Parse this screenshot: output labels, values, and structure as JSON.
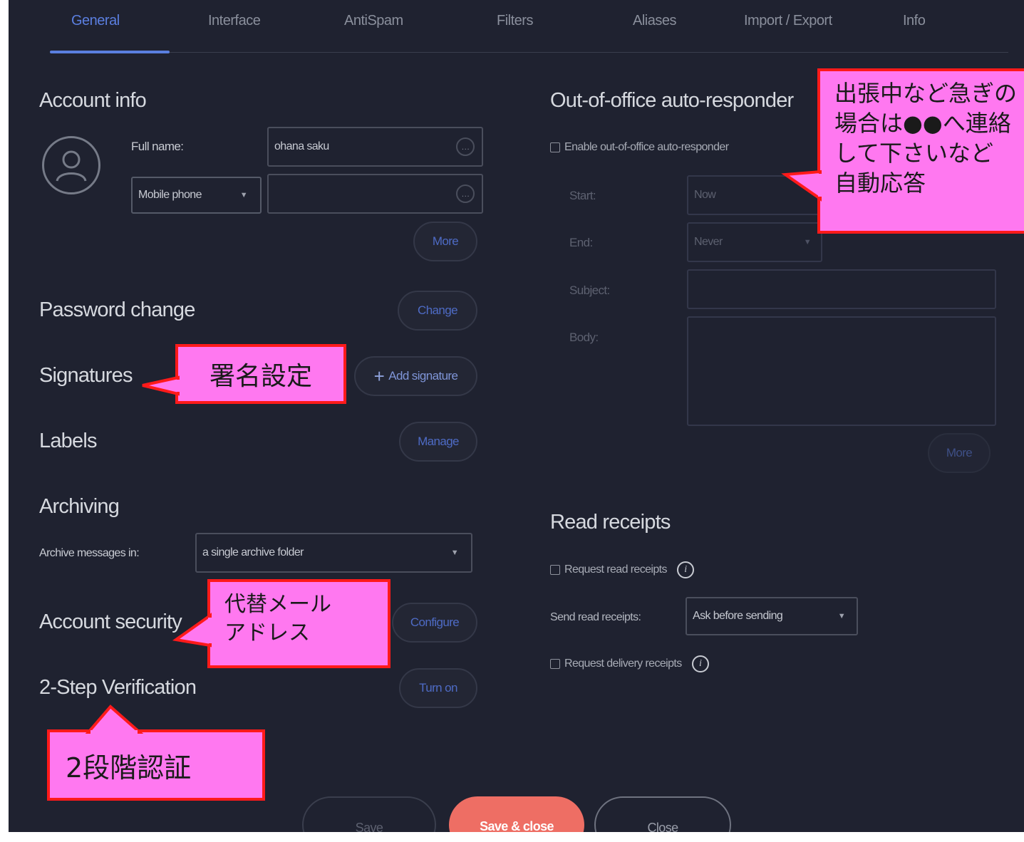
{
  "tabs": [
    {
      "label": "General",
      "active": true
    },
    {
      "label": "Interface"
    },
    {
      "label": "AntiSpam"
    },
    {
      "label": "Filters"
    },
    {
      "label": "Aliases"
    },
    {
      "label": "Import / Export"
    },
    {
      "label": "Info"
    }
  ],
  "account_info": {
    "title": "Account info",
    "full_name_label": "Full name:",
    "full_name_value": "ohana saku",
    "phone_type": "Mobile phone",
    "phone_value": "",
    "more_button": "More",
    "mini_button_icon": "ellipsis-icon"
  },
  "password": {
    "title": "Password change",
    "button": "Change"
  },
  "signatures": {
    "title": "Signatures",
    "button": "Add signature",
    "button_icon": "plus-icon"
  },
  "labels": {
    "title": "Labels",
    "button": "Manage"
  },
  "archiving": {
    "title": "Archiving",
    "label": "Archive messages in:",
    "value": "a single archive folder"
  },
  "account_security": {
    "title": "Account security",
    "button": "Configure"
  },
  "two_step": {
    "title": "2-Step Verification",
    "button": "Turn on"
  },
  "out_of_office": {
    "title": "Out-of-office auto-responder",
    "enable_label": "Enable out-of-office auto-responder",
    "start_label": "Start:",
    "start_value": "Now",
    "end_label": "End:",
    "end_value": "Never",
    "subject_label": "Subject:",
    "body_label": "Body:",
    "more_button": "More"
  },
  "read_receipts": {
    "title": "Read receipts",
    "request_label": "Request read receipts",
    "send_label": "Send read receipts:",
    "send_value": "Ask before sending",
    "delivery_label": "Request delivery receipts",
    "info_icon": "info-icon"
  },
  "footer": {
    "save": "Save",
    "save_close": "Save & close",
    "close": "Close"
  },
  "annotations": {
    "signature": "署名設定",
    "security": "代替メール\nアドレス",
    "two_step": "2段階認証",
    "auto_reply": "出張中など急ぎの\n場合は●●へ連絡\nして下さいなど\n自動応答"
  },
  "colors": {
    "background": "#1f2230",
    "accent": "#5a7fe0",
    "primary_button": "#ee6e64",
    "callout_fill": "#ff78f0",
    "callout_border": "#ff1a1a"
  }
}
